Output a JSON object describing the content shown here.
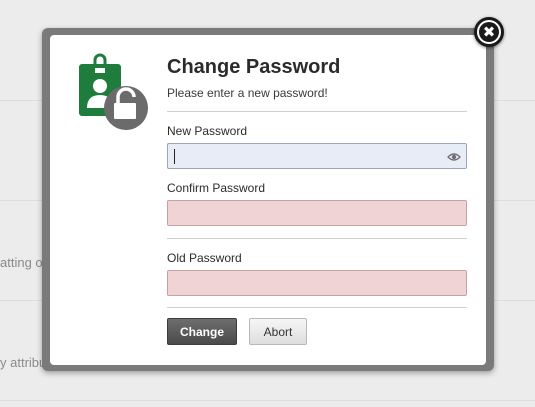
{
  "background": {
    "text_1": "atting of r",
    "text_2": "y attribut"
  },
  "dialog": {
    "title": "Change Password",
    "subtitle": "Please enter a new password!",
    "new_password": {
      "label": "New Password",
      "value": ""
    },
    "confirm_password": {
      "label": "Confirm Password",
      "value": ""
    },
    "old_password": {
      "label": "Old Password",
      "value": ""
    },
    "change_label": "Change",
    "abort_label": "Abort",
    "close_glyph": "✖"
  },
  "colors": {
    "icon_green": "#1e7d3c",
    "icon_gray": "#6b6b6b",
    "error_field": "#f0d3d5",
    "active_field": "#e8ecf6"
  },
  "icons": [
    "id-badge-icon",
    "unlock-icon",
    "eye-icon",
    "close-icon"
  ]
}
